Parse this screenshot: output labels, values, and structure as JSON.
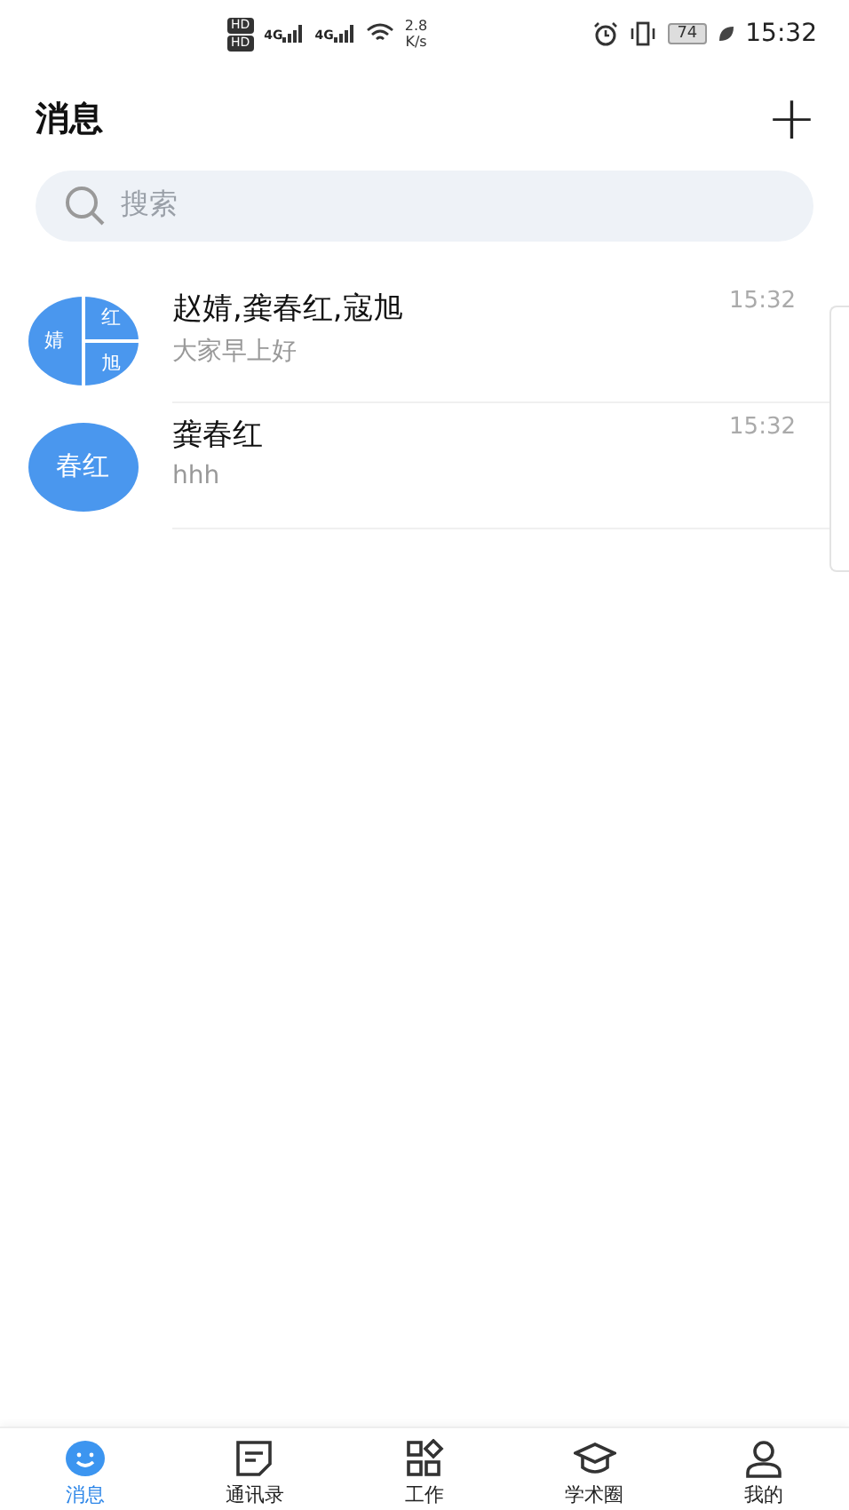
{
  "status_bar": {
    "sims": [
      {
        "badge": "HD",
        "network": "4G"
      },
      {
        "badge": "HD",
        "network": "4G"
      }
    ],
    "speed_value": "2.8",
    "speed_unit": "K/s",
    "battery": "74",
    "time": "15:32"
  },
  "header": {
    "title": "消息",
    "add": "+"
  },
  "search": {
    "placeholder": "搜索"
  },
  "conversations": [
    {
      "kind": "group",
      "avatar": [
        "婧",
        "红",
        "旭"
      ],
      "name": "赵婧,龚春红,寇旭",
      "preview": "大家早上好",
      "time": "15:32"
    },
    {
      "kind": "single",
      "avatar": [
        "春红"
      ],
      "name": "龚春红",
      "preview": "hhh",
      "time": "15:32"
    }
  ],
  "tabs": [
    {
      "kind": "chat",
      "label": "消息",
      "selected": true
    },
    {
      "kind": "contacts",
      "label": "通讯录",
      "selected": false
    },
    {
      "kind": "work",
      "label": "工作",
      "selected": false
    },
    {
      "kind": "academic",
      "label": "学术圈",
      "selected": false
    },
    {
      "kind": "me",
      "label": "我的",
      "selected": false
    }
  ]
}
